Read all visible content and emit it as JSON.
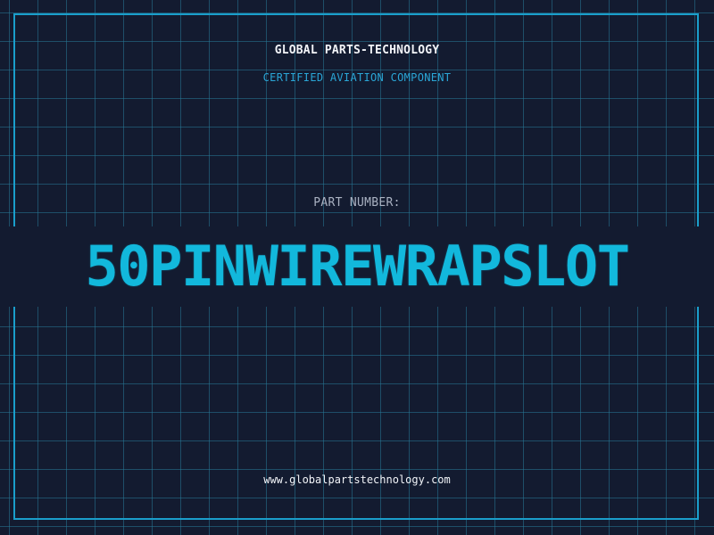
{
  "header": {
    "company": "GLOBAL PARTS-TECHNOLOGY",
    "subtitle": "CERTIFIED AVIATION COMPONENT"
  },
  "part": {
    "label": "PART NUMBER:",
    "number": "50PINWIREWRAPSLOT"
  },
  "footer": {
    "website": "www.globalpartstechnology.com"
  },
  "colors": {
    "background": "#131b30",
    "grid": "#26789a",
    "accent": "#12b8dc",
    "frame": "#1a9ecb",
    "text": "#f2f4f8"
  }
}
